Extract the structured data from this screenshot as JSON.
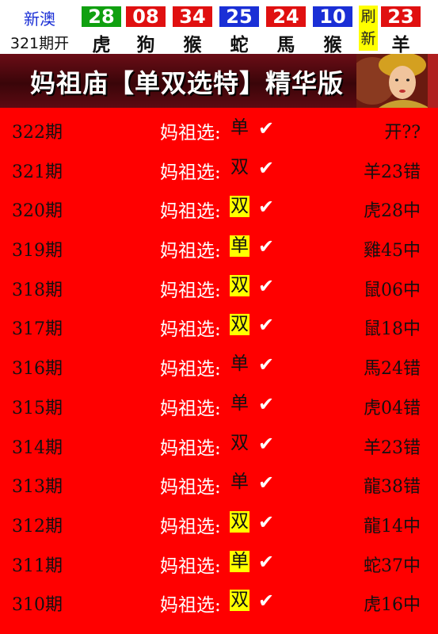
{
  "topbar": {
    "lottery_name": "新澳",
    "issue_open": "321期开",
    "refresh_label": "刷新",
    "balls": [
      {
        "number": "28",
        "zodiac": "虎",
        "color": "#10a010"
      },
      {
        "number": "08",
        "zodiac": "狗",
        "color": "#e01010"
      },
      {
        "number": "34",
        "zodiac": "猴",
        "color": "#e01010"
      },
      {
        "number": "25",
        "zodiac": "蛇",
        "color": "#1a2fd6"
      },
      {
        "number": "24",
        "zodiac": "馬",
        "color": "#e01010"
      },
      {
        "number": "10",
        "zodiac": "猴",
        "color": "#1a2fd6"
      },
      {
        "number": "23",
        "zodiac": "羊",
        "color": "#e01010"
      }
    ]
  },
  "banner": {
    "title": "妈祖庙【单双选特】精华版",
    "image": "mazu-goddess-statue"
  },
  "pick_label": "妈祖选:",
  "check_icon": "checkmark-icon",
  "rows": [
    {
      "issue": "322期",
      "pick": "单",
      "highlight": false,
      "result": "开??"
    },
    {
      "issue": "321期",
      "pick": "双",
      "highlight": false,
      "result": "羊23错"
    },
    {
      "issue": "320期",
      "pick": "双",
      "highlight": true,
      "result": "虎28中"
    },
    {
      "issue": "319期",
      "pick": "单",
      "highlight": true,
      "result": "雞45中"
    },
    {
      "issue": "318期",
      "pick": "双",
      "highlight": true,
      "result": "鼠06中"
    },
    {
      "issue": "317期",
      "pick": "双",
      "highlight": true,
      "result": "鼠18中"
    },
    {
      "issue": "316期",
      "pick": "单",
      "highlight": false,
      "result": "馬24错"
    },
    {
      "issue": "315期",
      "pick": "单",
      "highlight": false,
      "result": "虎04错"
    },
    {
      "issue": "314期",
      "pick": "双",
      "highlight": false,
      "result": "羊23错"
    },
    {
      "issue": "313期",
      "pick": "单",
      "highlight": false,
      "result": "龍38错"
    },
    {
      "issue": "312期",
      "pick": "双",
      "highlight": true,
      "result": "龍14中"
    },
    {
      "issue": "311期",
      "pick": "单",
      "highlight": true,
      "result": "蛇37中"
    },
    {
      "issue": "310期",
      "pick": "双",
      "highlight": true,
      "result": "虎16中"
    }
  ]
}
